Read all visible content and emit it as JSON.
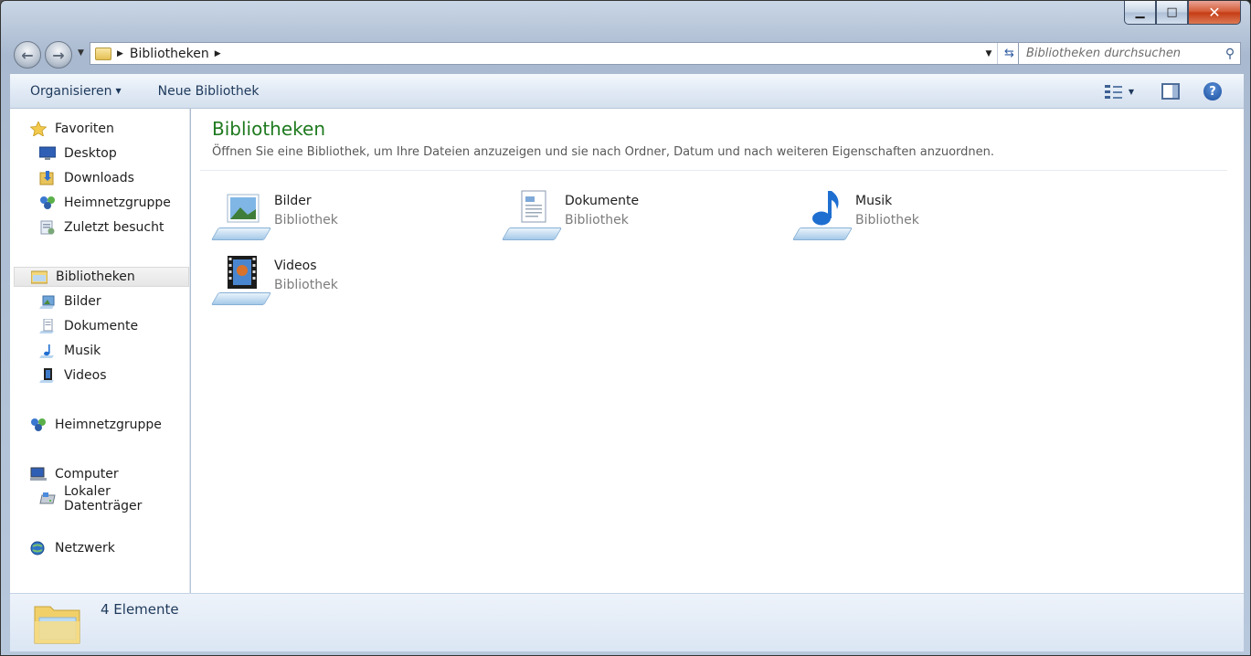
{
  "window": {
    "caption_buttons": {
      "minimize": "▁",
      "maximize": "□",
      "close": "✕"
    }
  },
  "nav": {
    "back_icon": "back-arrow-icon",
    "forward_icon": "forward-arrow-icon",
    "address": {
      "segments": [
        "Bibliotheken"
      ]
    },
    "search": {
      "placeholder": "Bibliotheken durchsuchen"
    }
  },
  "toolbar": {
    "organize_label": "Organisieren",
    "new_library_label": "Neue Bibliothek"
  },
  "sidebar": {
    "favorites": {
      "label": "Favoriten",
      "items": [
        {
          "label": "Desktop",
          "icon": "desktop-icon"
        },
        {
          "label": "Downloads",
          "icon": "downloads-icon"
        },
        {
          "label": "Heimnetzgruppe",
          "icon": "homegroup-icon"
        },
        {
          "label": "Zuletzt besucht",
          "icon": "recent-places-icon"
        }
      ]
    },
    "libraries": {
      "label": "Bibliotheken",
      "items": [
        {
          "label": "Bilder",
          "icon": "pictures-icon"
        },
        {
          "label": "Dokumente",
          "icon": "documents-icon"
        },
        {
          "label": "Musik",
          "icon": "music-icon"
        },
        {
          "label": "Videos",
          "icon": "videos-icon"
        }
      ]
    },
    "homegroup": {
      "label": "Heimnetzgruppe"
    },
    "computer": {
      "label": "Computer",
      "items": [
        {
          "label": "Lokaler Datenträger",
          "icon": "local-disk-icon"
        }
      ]
    },
    "network": {
      "label": "Netzwerk"
    }
  },
  "main": {
    "title": "Bibliotheken",
    "description": "Öffnen Sie eine Bibliothek, um Ihre Dateien anzuzeigen und sie nach Ordner, Datum und nach weiteren Eigenschaften anzuordnen.",
    "libraries": [
      {
        "name": "Bilder",
        "type": "Bibliothek",
        "icon": "pictures-library-icon"
      },
      {
        "name": "Dokumente",
        "type": "Bibliothek",
        "icon": "documents-library-icon"
      },
      {
        "name": "Musik",
        "type": "Bibliothek",
        "icon": "music-library-icon"
      },
      {
        "name": "Videos",
        "type": "Bibliothek",
        "icon": "videos-library-icon"
      }
    ]
  },
  "status": {
    "count_text": "4 Elemente"
  },
  "colors": {
    "title_green": "#1f7a1f",
    "toolbar_text": "#1e395b",
    "secondary_text": "#7c7c7c"
  }
}
